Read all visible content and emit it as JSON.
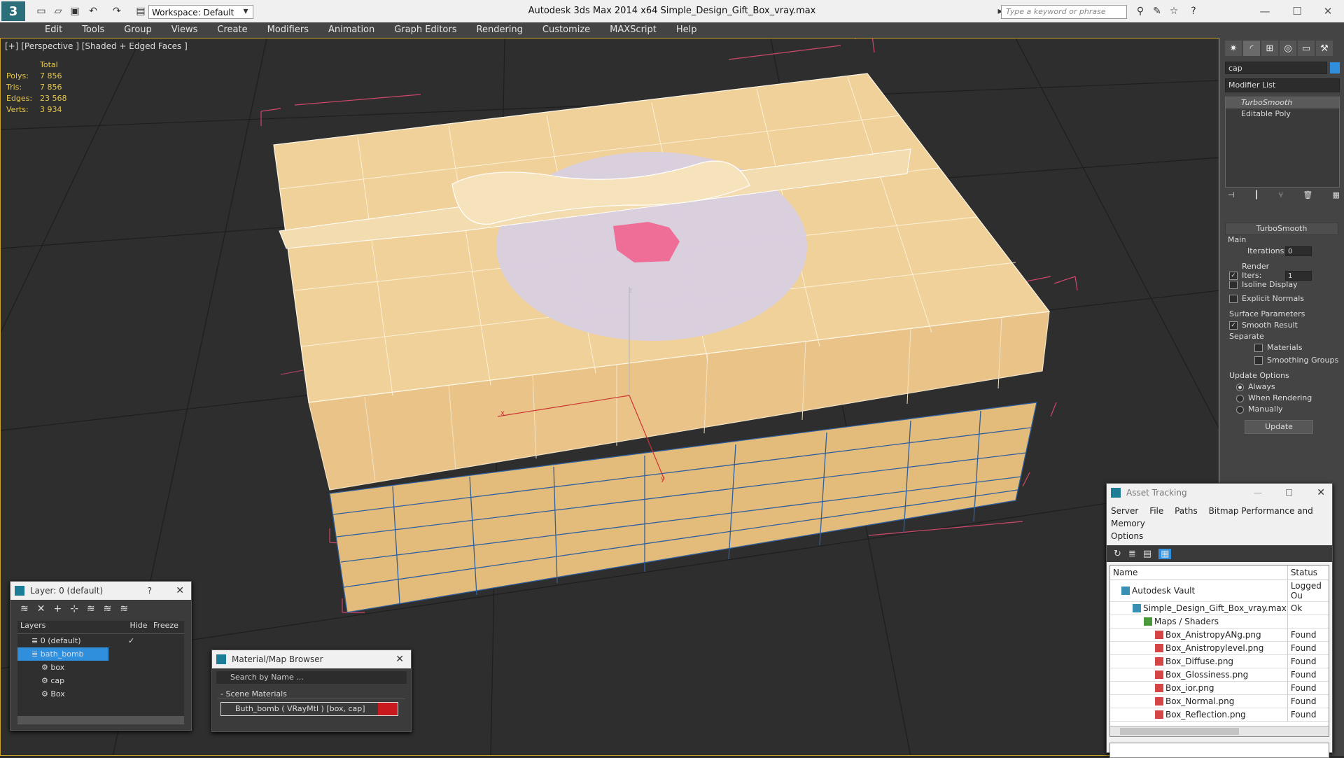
{
  "titlebar": {
    "app_title": "Autodesk 3ds Max  2014 x64      Simple_Design_Gift_Box_vray.max",
    "workspace": "Workspace: Default",
    "search_placeholder": "Type a keyword or phrase"
  },
  "menubar": [
    "Edit",
    "Tools",
    "Group",
    "Views",
    "Create",
    "Modifiers",
    "Animation",
    "Graph Editors",
    "Rendering",
    "Customize",
    "MAXScript",
    "Help"
  ],
  "viewport": {
    "label": "[+] [Perspective ] [Shaded + Edged Faces ]",
    "stats": {
      "header": "Total",
      "rows": [
        {
          "label": "Polys:",
          "value": "7 856"
        },
        {
          "label": "Tris:",
          "value": "7 856"
        },
        {
          "label": "Edges:",
          "value": "23 568"
        },
        {
          "label": "Verts:",
          "value": "3 934"
        }
      ]
    },
    "axis_labels": {
      "z": "z",
      "x": "x",
      "y": "y"
    }
  },
  "command_panel": {
    "object_name": "cap",
    "modifier_list": "Modifier List",
    "stack": [
      "TurboSmooth",
      "Editable Poly"
    ],
    "rollout": "TurboSmooth",
    "main_label": "Main",
    "iterations_label": "Iterations:",
    "iterations_value": "0",
    "render_iters_label": "Render Iters:",
    "render_iters_value": "1",
    "isoline": "Isoline Display",
    "explicit_normals": "Explicit Normals",
    "surface_params": "Surface Parameters",
    "smooth_result": "Smooth Result",
    "separate": "Separate",
    "materials": "Materials",
    "smoothing_groups": "Smoothing Groups",
    "update_options": "Update Options",
    "always": "Always",
    "when_rendering": "When Rendering",
    "manually": "Manually",
    "update_btn": "Update"
  },
  "layer_panel": {
    "title": "Layer: 0 (default)",
    "help": "?",
    "columns": [
      "Layers",
      "Hide",
      "Freeze"
    ],
    "rows": [
      {
        "name": "0 (default)",
        "indent": 1
      },
      {
        "name": "bath_bomb",
        "indent": 1
      },
      {
        "name": "box",
        "indent": 2
      },
      {
        "name": "cap",
        "indent": 2
      },
      {
        "name": "Box",
        "indent": 2
      }
    ]
  },
  "material_browser": {
    "title": "Material/Map Browser",
    "search_placeholder": "Search by Name ...",
    "section": "- Scene Materials",
    "item": "Buth_bomb  ( VRayMtl ) [box, cap]"
  },
  "asset_tracking": {
    "title": "Asset Tracking",
    "menu": [
      "Server",
      "File",
      "Paths",
      "Bitmap Performance and Memory",
      "Options"
    ],
    "columns": [
      "Name",
      "Status"
    ],
    "rows": [
      {
        "name": "Autodesk Vault",
        "status": "Logged Ou",
        "indent": 1
      },
      {
        "name": "Simple_Design_Gift_Box_vray.max",
        "status": "Ok",
        "indent": 2
      },
      {
        "name": "Maps / Shaders",
        "status": "",
        "indent": 3
      },
      {
        "name": "Box_AnistropyANg.png",
        "status": "Found",
        "indent": 4
      },
      {
        "name": "Box_Anistropylevel.png",
        "status": "Found",
        "indent": 4
      },
      {
        "name": "Box_Diffuse.png",
        "status": "Found",
        "indent": 4
      },
      {
        "name": "Box_Glossiness.png",
        "status": "Found",
        "indent": 4
      },
      {
        "name": "Box_ior.png",
        "status": "Found",
        "indent": 4
      },
      {
        "name": "Box_Normal.png",
        "status": "Found",
        "indent": 4
      },
      {
        "name": "Box_Reflection.png",
        "status": "Found",
        "indent": 4
      }
    ]
  },
  "colors": {
    "viewport_bg": "#2e2e2e",
    "box_color": "#e8c48a",
    "selection_blue": "#2f8fdc",
    "accent_yellow": "#e6c84a"
  }
}
